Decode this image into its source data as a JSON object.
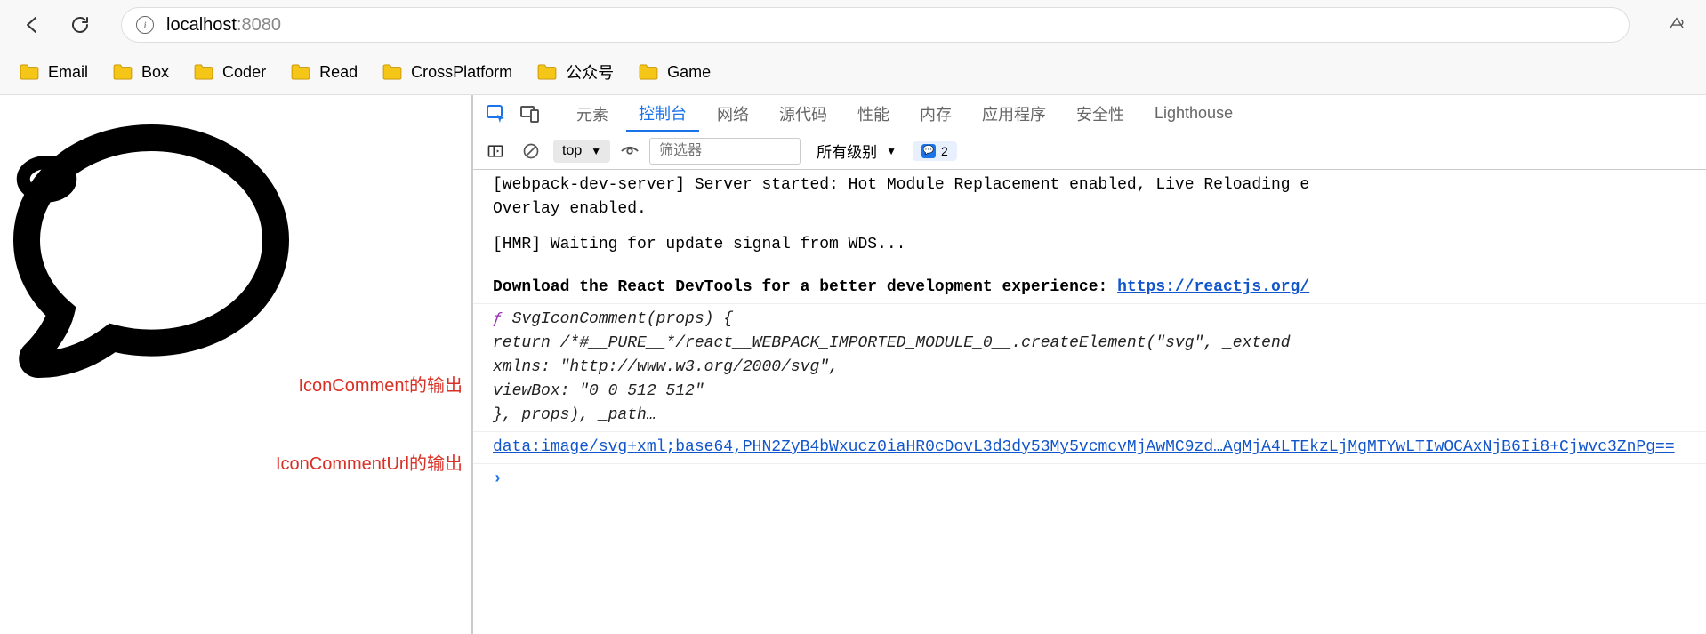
{
  "url": {
    "host": "localhost",
    "port": ":8080"
  },
  "bookmarks": [
    {
      "label": "Email"
    },
    {
      "label": "Box"
    },
    {
      "label": "Coder"
    },
    {
      "label": "Read"
    },
    {
      "label": "CrossPlatform"
    },
    {
      "label": "公众号"
    },
    {
      "label": "Game"
    }
  ],
  "annotations": {
    "icon_comment": "IconComment的输出",
    "icon_comment_url": "IconCommentUrl的输出"
  },
  "devtools": {
    "tabs": [
      "元素",
      "控制台",
      "网络",
      "源代码",
      "性能",
      "内存",
      "应用程序",
      "安全性",
      "Lighthouse"
    ],
    "active_tab_index": 1,
    "toolbar": {
      "context": "top",
      "filter_placeholder": "筛选器",
      "level_label": "所有级别",
      "issue_count": "2"
    },
    "console": {
      "line1a": "[webpack-dev-server] Server started: Hot Module Replacement enabled, Live Reloading e",
      "line1b": "Overlay enabled.",
      "line2": "[HMR] Waiting for update signal from WDS...",
      "line3_text": "Download the React DevTools for a better development experience: ",
      "line3_link": "https://reactjs.org/",
      "code_l1": "SvgIconComment(props) {",
      "code_l2": "  return /*#__PURE__*/react__WEBPACK_IMPORTED_MODULE_0__.createElement(\"svg\", _extend",
      "code_l3": "    xmlns: \"http://www.w3.org/2000/svg\",",
      "code_l4": "    viewBox: \"0 0 512 512\"",
      "code_l5": "  }, props), _path…",
      "data_url": "data:image/svg+xml;base64,PHN2ZyB4bWxucz0iaHR0cDovL3d3dy53My5vcmcvMjAwMC9zd…AgMjA4LTEkzLjMgMTYwLTIwOCAxNjB6Ii8+Cjwvc3ZnPg==",
      "prompt": "›"
    }
  }
}
